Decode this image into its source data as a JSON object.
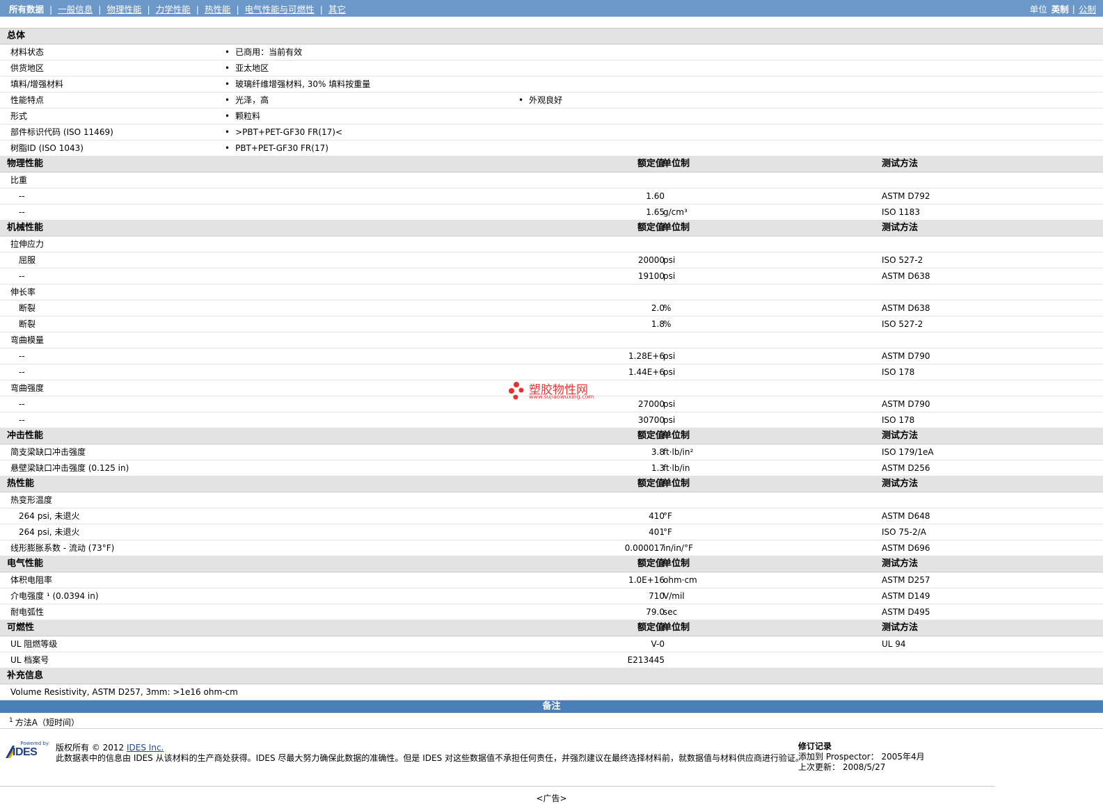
{
  "nav": {
    "items": [
      {
        "label": "所有数据",
        "current": true
      },
      {
        "label": "一般信息",
        "current": false
      },
      {
        "label": "物理性能",
        "current": false
      },
      {
        "label": "力学性能",
        "current": false
      },
      {
        "label": "热性能",
        "current": false
      },
      {
        "label": "电气性能与可燃性",
        "current": false
      },
      {
        "label": "其它",
        "current": false
      }
    ],
    "unit_label": "单位",
    "unit_english": "英制",
    "unit_metric": "公制"
  },
  "general": {
    "title": "总体",
    "rows": [
      {
        "label": "材料状态",
        "v1": "已商用：当前有效",
        "v2": ""
      },
      {
        "label": "供货地区",
        "v1": "亚太地区",
        "v2": ""
      },
      {
        "label": "填料/增强材料",
        "v1": "玻璃纤维增强材料, 30% 填料按重量",
        "v2": ""
      },
      {
        "label": "性能特点",
        "v1": "光泽，高",
        "v2": "外观良好"
      },
      {
        "label": "形式",
        "v1": "颗粒料",
        "v2": ""
      },
      {
        "label": "部件标识代码 (ISO 11469)",
        "v1": ">PBT+PET-GF30 FR(17)<",
        "v2": ""
      },
      {
        "label": "树脂ID (ISO 1043)",
        "v1": "PBT+PET-GF30 FR(17)",
        "v2": ""
      }
    ]
  },
  "headers": {
    "value": "额定值",
    "unit": "单位制",
    "method": "测试方法"
  },
  "sections": [
    {
      "title": "物理性能",
      "rows": [
        {
          "label": "比重",
          "value": "",
          "unit": "",
          "method": "",
          "indent": false
        },
        {
          "label": "--",
          "value": "1.60",
          "unit": "",
          "method": "ASTM D792",
          "indent": true
        },
        {
          "label": "--",
          "value": "1.65",
          "unit": "g/cm³",
          "method": "ISO 1183",
          "indent": true
        }
      ]
    },
    {
      "title": "机械性能",
      "rows": [
        {
          "label": "拉伸应力",
          "value": "",
          "unit": "",
          "method": "",
          "indent": false
        },
        {
          "label": "屈服",
          "value": "20000",
          "unit": "psi",
          "method": "ISO 527-2",
          "indent": true
        },
        {
          "label": "--",
          "value": "19100",
          "unit": "psi",
          "method": "ASTM D638",
          "indent": true
        },
        {
          "label": "伸长率",
          "value": "",
          "unit": "",
          "method": "",
          "indent": false
        },
        {
          "label": "断裂",
          "value": "2.0",
          "unit": "%",
          "method": "ASTM D638",
          "indent": true
        },
        {
          "label": "断裂",
          "value": "1.8",
          "unit": "%",
          "method": "ISO 527-2",
          "indent": true
        },
        {
          "label": "弯曲模量",
          "value": "",
          "unit": "",
          "method": "",
          "indent": false
        },
        {
          "label": "--",
          "value": "1.28E+6",
          "unit": "psi",
          "method": "ASTM D790",
          "indent": true
        },
        {
          "label": "--",
          "value": "1.44E+6",
          "unit": "psi",
          "method": "ISO 178",
          "indent": true
        },
        {
          "label": "弯曲强度",
          "value": "",
          "unit": "",
          "method": "",
          "indent": false
        },
        {
          "label": "--",
          "value": "27000",
          "unit": "psi",
          "method": "ASTM D790",
          "indent": true
        },
        {
          "label": "--",
          "value": "30700",
          "unit": "psi",
          "method": "ISO 178",
          "indent": true
        }
      ]
    },
    {
      "title": "冲击性能",
      "rows": [
        {
          "label": "简支梁缺口冲击强度",
          "value": "3.8",
          "unit": "ft·lb/in²",
          "method": "ISO 179/1eA",
          "indent": false
        },
        {
          "label": "悬壁梁缺口冲击强度 (0.125 in)",
          "value": "1.3",
          "unit": "ft·lb/in",
          "method": "ASTM D256",
          "indent": false
        }
      ]
    },
    {
      "title": "热性能",
      "rows": [
        {
          "label": "热变形温度",
          "value": "",
          "unit": "",
          "method": "",
          "indent": false
        },
        {
          "label": "264 psi, 未退火",
          "value": "410",
          "unit": "°F",
          "method": "ASTM D648",
          "indent": true
        },
        {
          "label": "264 psi, 未退火",
          "value": "401",
          "unit": "°F",
          "method": "ISO 75-2/A",
          "indent": true
        },
        {
          "label": "线形膨胀系数 - 流动 (73°F)",
          "value": "0.000017",
          "unit": "in/in/°F",
          "method": "ASTM D696",
          "indent": false
        }
      ]
    },
    {
      "title": "电气性能",
      "rows": [
        {
          "label": "体积电阻率",
          "value": "1.0E+16",
          "unit": "ohm·cm",
          "method": "ASTM D257",
          "indent": false
        },
        {
          "label": "介电强度 ¹ (0.0394 in)",
          "value": "710",
          "unit": "V/mil",
          "method": "ASTM D149",
          "indent": false
        },
        {
          "label": "耐电弧性",
          "value": "79.0",
          "unit": "sec",
          "method": "ASTM D495",
          "indent": false
        }
      ]
    },
    {
      "title": "可燃性",
      "rows": [
        {
          "label": "UL 阻燃等级",
          "value": "V-0",
          "unit": "",
          "method": "UL 94",
          "indent": false
        },
        {
          "label": "UL 档案号",
          "value": "E213445",
          "unit": "",
          "method": "",
          "indent": false
        }
      ]
    }
  ],
  "supplement": {
    "title": "补充信息",
    "text": "Volume Resistivity, ASTM D257, 3mm: >1e16 ohm-cm"
  },
  "notes": {
    "title": "备注",
    "footnote_mark": "1",
    "footnote": "方法A（短时间）"
  },
  "footer": {
    "powered_by": "Powered by",
    "logo_text": "IDES",
    "copyright_prefix": "版权所有 © 2012",
    "copyright_link": "IDES Inc.",
    "disclaimer": "此数据表中的信息由 IDES 从该材料的生产商处获得。IDES 尽最大努力确保此数据的准确性。但是 IDES 对这些数据值不承担任何责任，并强烈建议在最终选择材料前，就数据值与材料供应商进行验证。",
    "revision_title": "修订记录",
    "added_line": "添加到 Prospector： 2005年4月",
    "updated_line": "上次更新： 2008/5/27"
  },
  "watermark": {
    "title": "塑胶物性网",
    "url": "www.sujiaowuxing.com"
  },
  "ad_label": "<广告>"
}
